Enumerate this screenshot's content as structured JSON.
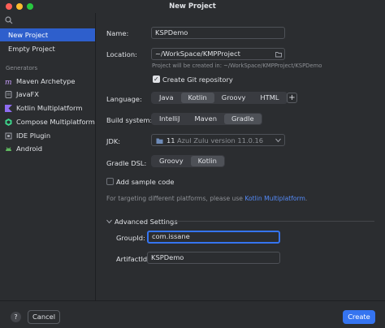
{
  "window": {
    "title": "New Project"
  },
  "sidebar": {
    "items": [
      {
        "label": "New Project"
      },
      {
        "label": "Empty Project"
      }
    ],
    "generators_heading": "Generators",
    "generators": [
      {
        "label": "Maven Archetype",
        "icon": "maven-icon"
      },
      {
        "label": "JavaFX",
        "icon": "javafx-icon"
      },
      {
        "label": "Kotlin Multiplatform",
        "icon": "kotlin-icon"
      },
      {
        "label": "Compose Multiplatform",
        "icon": "compose-icon"
      },
      {
        "label": "IDE Plugin",
        "icon": "plugin-icon"
      },
      {
        "label": "Android",
        "icon": "android-icon"
      }
    ]
  },
  "form": {
    "name_label": "Name:",
    "name_value": "KSPDemo",
    "location_label": "Location:",
    "location_value": "~/WorkSpace/KMPProject",
    "location_hint": "Project will be created in: ~/WorkSpace/KMPProject/KSPDemo",
    "git_label": "Create Git repository",
    "language_label": "Language:",
    "languages": [
      "Java",
      "Kotlin",
      "Groovy",
      "HTML"
    ],
    "build_label": "Build system:",
    "build_systems": [
      "IntelliJ",
      "Maven",
      "Gradle"
    ],
    "jdk_label": "JDK:",
    "jdk_version": "11",
    "jdk_value": "Azul Zulu version 11.0.16",
    "dsl_label": "Gradle DSL:",
    "dsl_options": [
      "Groovy",
      "Kotlin"
    ],
    "sample_label": "Add sample code",
    "targeting_text": "For targeting different platforms, please use",
    "targeting_link": "Kotlin Multiplatform",
    "targeting_end": ".",
    "advanced_label": "Advanced Settings",
    "groupid_label": "GroupId:",
    "groupid_value": "com.issane",
    "artifactid_label": "ArtifactId:",
    "artifactid_value": "KSPDemo"
  },
  "footer": {
    "help_label": "?",
    "cancel_label": "Cancel",
    "create_label": "Create"
  },
  "colors": {
    "accent": "#3574f0",
    "selection": "#2e5fcc",
    "link": "#548af7",
    "background": "#2b2d30"
  }
}
